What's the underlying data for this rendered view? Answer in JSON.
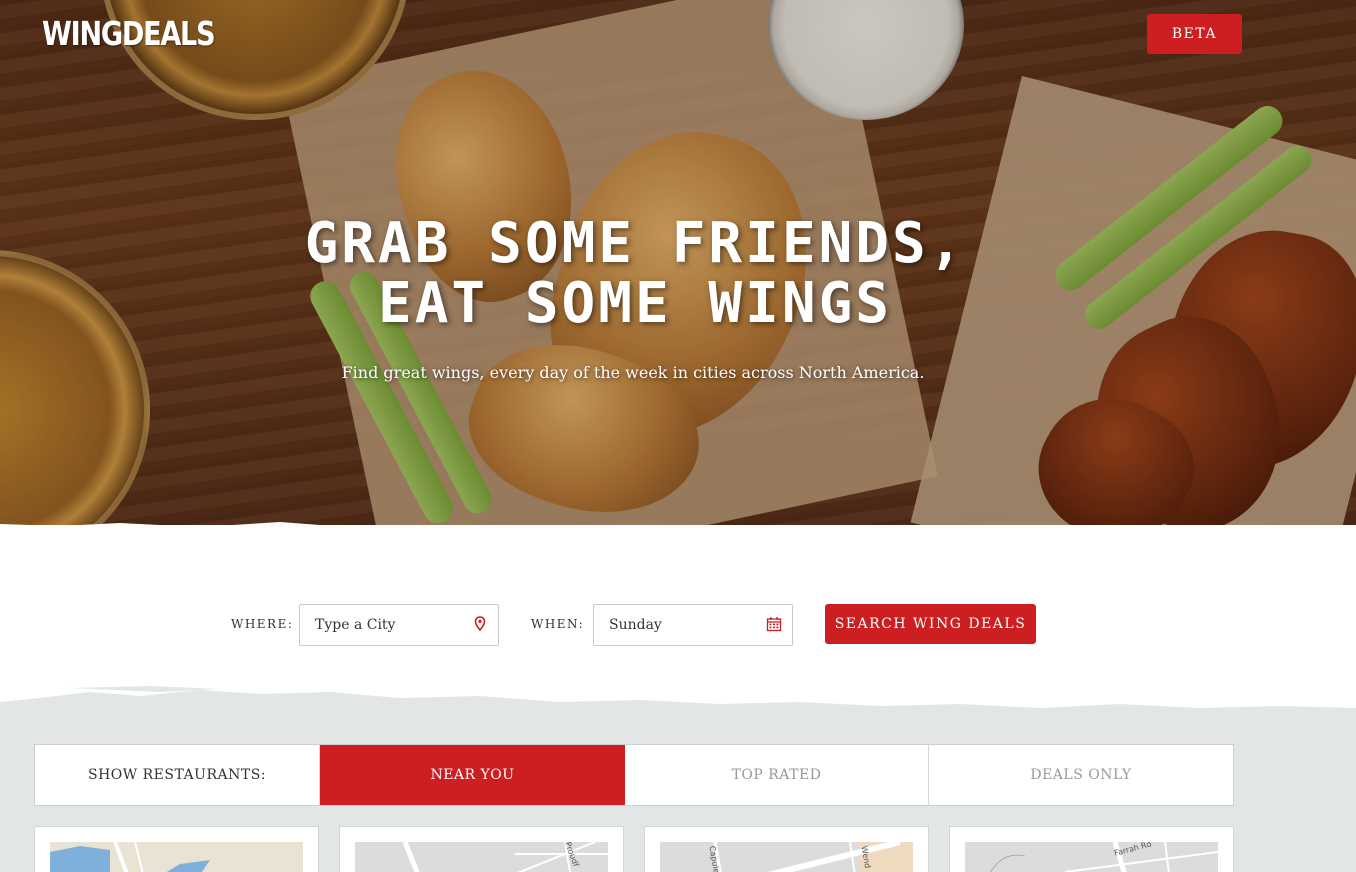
{
  "header": {
    "logo_text": "WINGDEALS",
    "beta_label": "BETA"
  },
  "hero": {
    "headline_line1": "GRAB SOME FRIENDS,",
    "headline_line2": "EAT SOME WINGS",
    "subheadline": "Find great wings, every day of the week in cities across North America."
  },
  "search": {
    "where_label": "WHERE:",
    "where_placeholder": "Type a City",
    "where_icon": "map-pin-icon",
    "when_label": "WHEN:",
    "when_value": "Sunday",
    "when_icon": "calendar-icon",
    "submit_label": "SEARCH WING DEALS"
  },
  "filters": {
    "label": "SHOW RESTAURANTS:",
    "tabs": [
      {
        "label": "NEAR YOU",
        "active": true
      },
      {
        "label": "TOP RATED",
        "active": false
      },
      {
        "label": "DEALS ONLY",
        "active": false
      }
    ]
  },
  "cards": [
    {
      "map_labels": []
    },
    {
      "map_labels": [
        "Proudf"
      ]
    },
    {
      "map_labels": [
        "Capulet",
        "Wend"
      ]
    },
    {
      "map_labels": [
        "Farrah Rd"
      ]
    }
  ],
  "colors": {
    "accent": "#cd1f22",
    "page_bg": "#e3e6e7"
  }
}
